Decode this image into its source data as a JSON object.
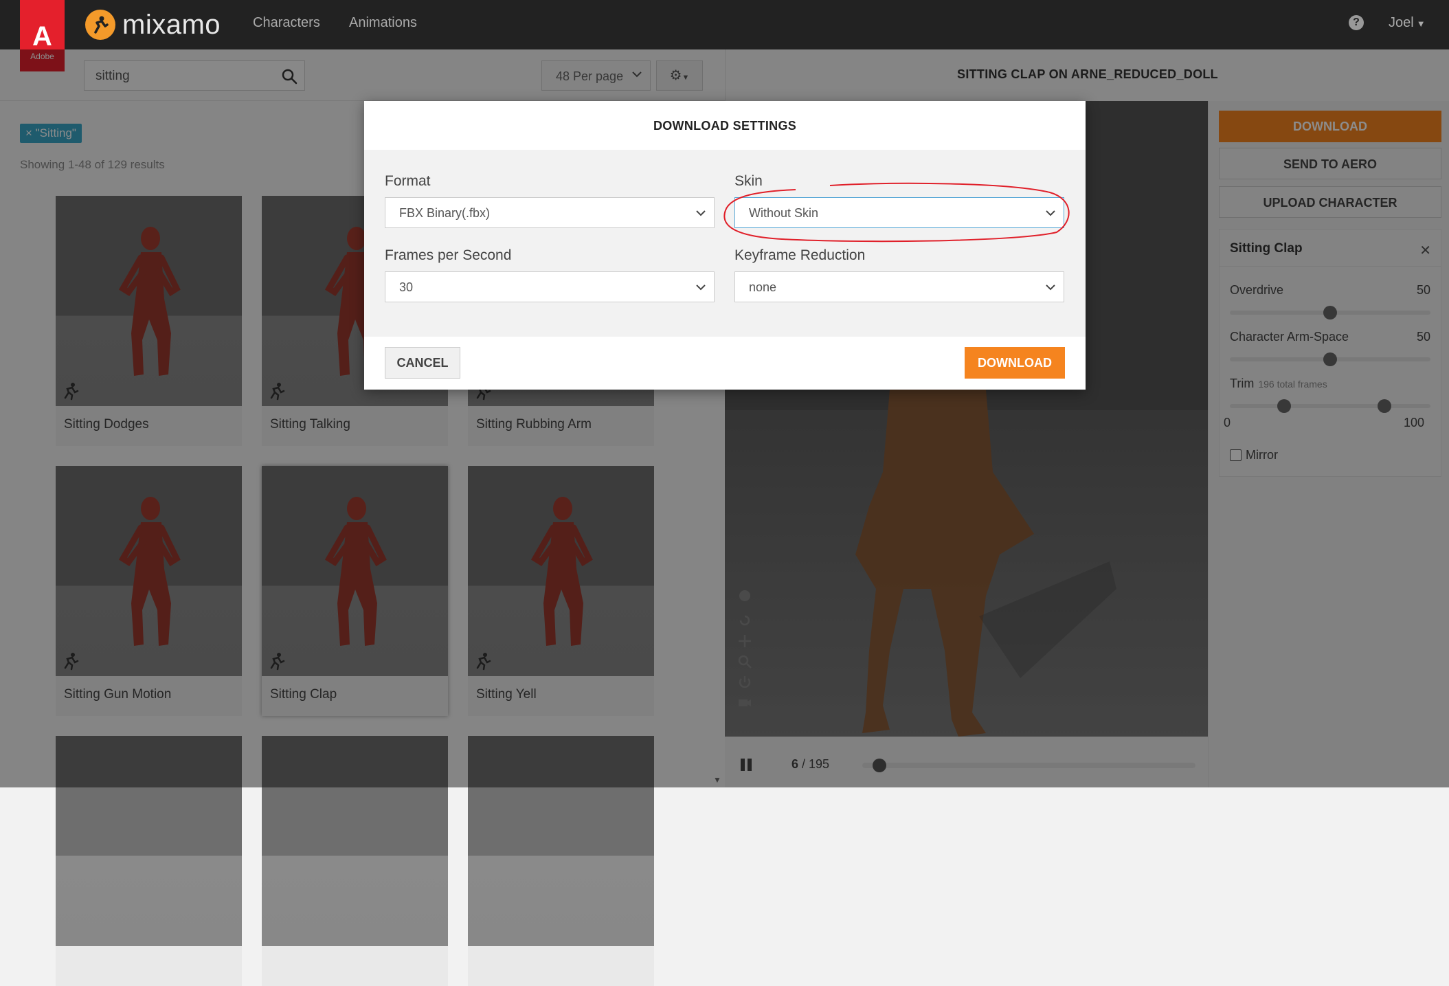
{
  "topbar": {
    "adobe_logo_text": "Adobe",
    "brand_name": "mixamo",
    "nav": [
      "Characters",
      "Animations"
    ],
    "help_label": "?",
    "user_name": "Joel"
  },
  "search": {
    "value": "sitting",
    "per_page": "48 Per page"
  },
  "filter_tag": "× \"Sitting\"",
  "results_count": "Showing 1-48 of 129 results",
  "animations": [
    {
      "label": "Sitting Dodges"
    },
    {
      "label": "Sitting Talking"
    },
    {
      "label": "Sitting Rubbing Arm"
    },
    {
      "label": "Sitting Gun Motion"
    },
    {
      "label": "Sitting Clap",
      "selected": true
    },
    {
      "label": "Sitting Yell"
    }
  ],
  "viewer": {
    "title": "SITTING CLAP ON ARNE_REDUCED_DOLL",
    "current_frame": "6",
    "total_frames": "/ 195",
    "playback_progress": 0.03
  },
  "side": {
    "download": "DOWNLOAD",
    "send_to_aero": "SEND TO AERO",
    "upload_character": "UPLOAD CHARACTER",
    "settings_title": "Sitting Clap",
    "overdrive_label": "Overdrive",
    "overdrive_value": "50",
    "arm_space_label": "Character Arm-Space",
    "arm_space_value": "50",
    "trim_label": "Trim",
    "trim_sub": "196 total frames",
    "trim_start": "0",
    "trim_end": "100",
    "mirror_label": "Mirror"
  },
  "modal": {
    "title": "DOWNLOAD SETTINGS",
    "format_label": "Format",
    "format_value": "FBX Binary(.fbx)",
    "skin_label": "Skin",
    "skin_value": "Without Skin",
    "fps_label": "Frames per Second",
    "fps_value": "30",
    "kfr_label": "Keyframe Reduction",
    "kfr_value": "none",
    "cancel": "CANCEL",
    "download": "DOWNLOAD"
  },
  "colors": {
    "accent": "#f5841f",
    "tag": "#3aa6c6",
    "adobe_red": "#e4202c",
    "annotation": "#e0202a"
  }
}
